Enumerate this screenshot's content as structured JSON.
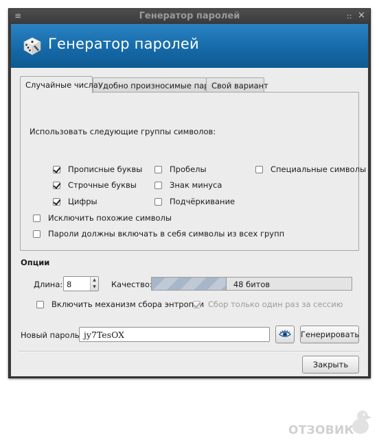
{
  "window": {
    "title": "Генератор паролей",
    "menu_glyph": "≡",
    "controls": [
      "::",
      "×"
    ]
  },
  "banner": {
    "title": "Генератор паролей",
    "icon": "dice-icon",
    "colors": {
      "top": "#2b83c2",
      "bottom": "#0f5a92"
    }
  },
  "tabs": [
    {
      "label": "Случайные числа",
      "active": true
    },
    {
      "label": "Удобно произносимые пароли",
      "active": false
    },
    {
      "label": "Свой вариант",
      "active": false
    }
  ],
  "groups": {
    "heading": "Использовать следующие группы символов:",
    "options": [
      {
        "label": "Прописные буквы",
        "checked": true
      },
      {
        "label": "Строчные буквы",
        "checked": true
      },
      {
        "label": "Цифры",
        "checked": true
      },
      {
        "label": "Пробелы",
        "checked": false
      },
      {
        "label": "Знак минуса",
        "checked": false
      },
      {
        "label": "Подчёркивание",
        "checked": false
      },
      {
        "label": "Специальные символы",
        "checked": false
      }
    ],
    "exclude_similar": {
      "label": "Исключить похожие символы",
      "checked": false
    },
    "all_groups": {
      "label": "Пароли должны включать в себя символы из всех групп",
      "checked": false
    }
  },
  "options": {
    "title": "Опции",
    "length_label": "Длина:",
    "length_value": "8",
    "quality_label": "Качество:",
    "quality_text": "48 битов",
    "quality_fraction": 0.375,
    "entropy": {
      "label": "Включить механизм сбора энтропии",
      "checked": false
    },
    "once_per_session": {
      "label": "Сбор только один раз за сессию",
      "checked": true,
      "disabled": true
    }
  },
  "password": {
    "label": "Новый пароль:",
    "value": "jy7TesOX",
    "toggle_icon": "eye-icon",
    "generate_label": "Генерировать"
  },
  "footer": {
    "close_label": "Закрыть"
  },
  "watermark": {
    "text": "ОТЗОВИК"
  }
}
